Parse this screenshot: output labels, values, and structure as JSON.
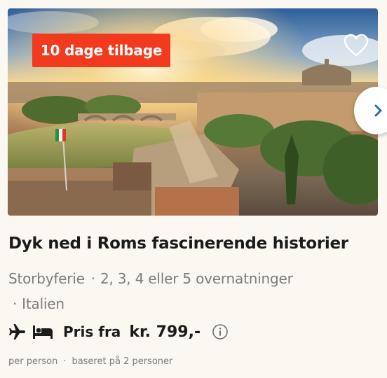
{
  "card": {
    "badge": "10 dage tilbage",
    "image_alt": "Rome skyline with the Tiber river and St. Peter's Basilica at sunset",
    "favorite_icon": "heart-outline-icon",
    "next_icon": "chevron-right-icon",
    "title": "Dyk ned i Roms fascinerende historier",
    "category": "Storbyferie",
    "nights": "2, 3, 4 eller 5 overnatninger",
    "country": "Italien",
    "separator": "·",
    "transport_icon": "airplane-icon",
    "hotel_icon": "bed-icon",
    "price_label": "Pris fra",
    "price_value": "kr. 799,-",
    "info_icon": "info-icon",
    "per_person": "per person",
    "based_on": "baseret på 2 personer"
  },
  "colors": {
    "badge_bg": "#f23a1e",
    "page_bg": "#fbf8f2",
    "text_dark": "#1b1b1b",
    "text_muted": "#7c7c7c"
  }
}
